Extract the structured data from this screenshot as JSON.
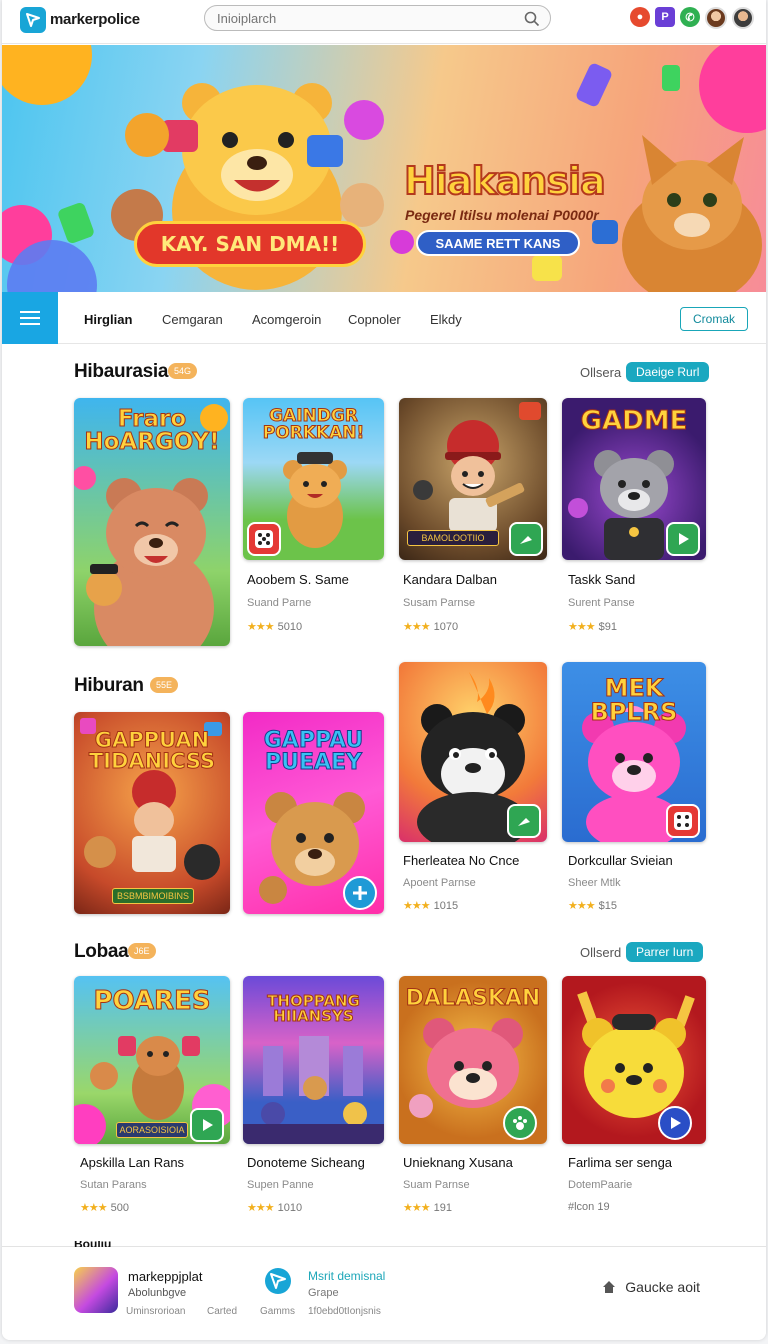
{
  "header": {
    "logo_text": "markerpolice",
    "search_placeholder": "Inioiplarch"
  },
  "hero": {
    "title": "Hiakansia",
    "subtitle": "Pegerel Itilsu molenai P0000r",
    "button_label": "SAAME RETT KANS",
    "ribbon_text": "KAY. SAN DMA!!"
  },
  "nav": {
    "tabs": [
      "Hirglian",
      "Cemgaran",
      "Acomgeroin",
      "Copnoler",
      "Elkdy"
    ],
    "right_button": "Cromak"
  },
  "sections": [
    {
      "title": "Hibaurasia",
      "badge": "54G",
      "other_label": "Ollsera",
      "pill_label": "Daeige Rurl",
      "cards": [
        {
          "title": "Fraro HoARGOY!",
          "name": "",
          "sub": "",
          "rating": ""
        },
        {
          "title": "GAINDGR PORKKAN!",
          "name": "Aoobem S. Same",
          "sub": "Suand Parne",
          "rating": "5010"
        },
        {
          "title": "",
          "tag": "BAMOLOOTIIO",
          "name": "Kandara Dalban",
          "sub": "Susam Parnse",
          "rating": "1070"
        },
        {
          "title": "GADME",
          "name": "Taskk Sand",
          "sub": "Surent Panse",
          "rating": "$91"
        }
      ]
    },
    {
      "title": "Hiburan",
      "badge": "55E",
      "cards": [
        {
          "title": "GAPPUAN TIDANICSS",
          "tag": "BSBMBIMOIBINS",
          "name": "",
          "sub": "",
          "rating": ""
        },
        {
          "title": "GAPPAU PUEAEY",
          "name": "",
          "sub": "",
          "rating": ""
        },
        {
          "title": "",
          "name": "Fherleatea No Cnce",
          "sub": "Apoent Parnse",
          "rating": "1015"
        },
        {
          "title": "MEK BPLRS",
          "name": "Dorkcullar Svieian",
          "sub": "Sheer Mtlk",
          "rating": "$15"
        }
      ]
    },
    {
      "title": "Lobaa",
      "badge": "J6E",
      "other_label": "Ollserd",
      "pill_label": "Parrer Iurn",
      "cards": [
        {
          "title": "POARES",
          "tag": "AORASOISIOIA",
          "name": "Apskilla Lan Rans",
          "sub": "Sutan Parans",
          "rating": "500"
        },
        {
          "title": "THOPPANG HIIANSYS",
          "name": "Donoteme Sicheang",
          "sub": "Supen Panne",
          "rating": "1010"
        },
        {
          "title": "DALASKAN",
          "name": "Unieknang Xusana",
          "sub": "Suam Parnse",
          "rating": "191"
        },
        {
          "title": "",
          "name": "Farlima ser senga",
          "sub": "DotemPaarie",
          "rating": "19",
          "rating_prefix": "#lcon"
        }
      ]
    }
  ],
  "footer": {
    "app_name": "markeppjplat",
    "app_sub": "Abolunbgve",
    "small_1": "Uminsrorioan",
    "small_2": "Carted",
    "small_3": "Gamms",
    "mid_title": "Msrit demisnal",
    "mid_sub": "Grape",
    "mid_small": "1f0ebd0tIonjsnis",
    "right_label": "Gaucke aoit",
    "peek_text": "Bouliu"
  },
  "stars": "★★★",
  "colors": {
    "accent": "#19a6e3",
    "teal": "#1aa8c0",
    "badge": "#f4b35b",
    "star": "#f2b01e"
  }
}
